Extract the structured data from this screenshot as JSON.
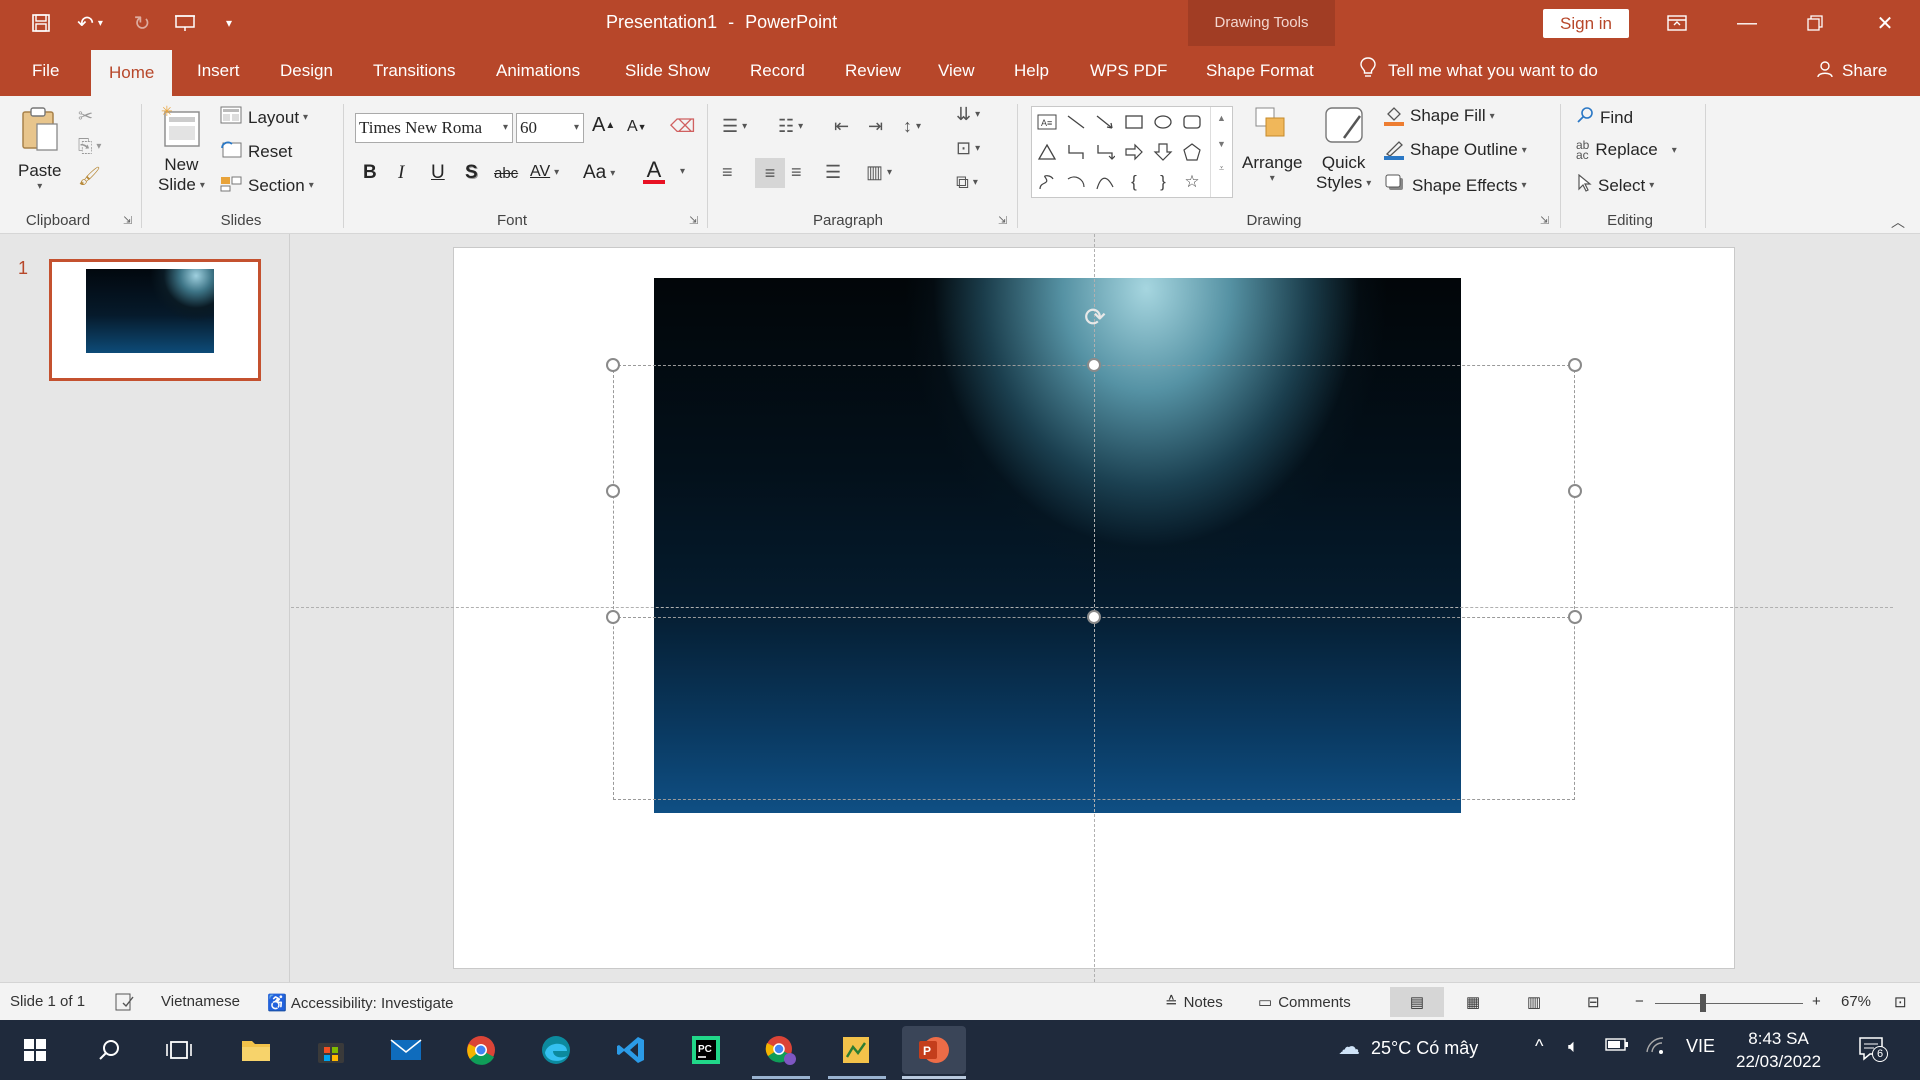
{
  "titlebar": {
    "document_title": "Presentation1",
    "separator": "-",
    "app_name": "PowerPoint",
    "contextual_group": "Drawing Tools",
    "signin": "Sign in",
    "quick_access_icons": [
      "save-icon",
      "undo-icon",
      "redo-icon",
      "present-from-beginning-icon",
      "customize-toolbar-icon"
    ]
  },
  "tabs": [
    "File",
    "Home",
    "Insert",
    "Design",
    "Transitions",
    "Animations",
    "Slide Show",
    "Record",
    "Review",
    "View",
    "Help",
    "WPS PDF",
    "Shape Format"
  ],
  "active_tab": "Home",
  "tell_me": "Tell me what you want to do",
  "share": "Share",
  "ribbon": {
    "clipboard": {
      "label": "Clipboard",
      "paste": "Paste"
    },
    "slides": {
      "label": "Slides",
      "new_slide_line1": "New",
      "new_slide_line2": "Slide",
      "layout": "Layout",
      "reset": "Reset",
      "section": "Section"
    },
    "font": {
      "label": "Font",
      "font_name": "Times New Roma",
      "font_size": "60",
      "bold": "B",
      "italic": "I",
      "underline": "U",
      "shadow": "S",
      "strikethrough": "abc",
      "spacing": "AV",
      "case": "Aa",
      "color": "A",
      "grow": "A",
      "shrink": "A"
    },
    "paragraph": {
      "label": "Paragraph"
    },
    "drawing": {
      "label": "Drawing",
      "arrange": "Arrange",
      "quick_styles_line1": "Quick",
      "quick_styles_line2": "Styles",
      "shape_fill": "Shape Fill",
      "shape_outline": "Shape Outline",
      "shape_effects": "Shape Effects"
    },
    "editing": {
      "label": "Editing",
      "find": "Find",
      "replace": "Replace",
      "select": "Select"
    }
  },
  "thumbnails": [
    {
      "number": "1"
    }
  ],
  "statusbar": {
    "slide_info": "Slide 1 of 1",
    "language": "Vietnamese",
    "accessibility": "Accessibility: Investigate",
    "notes": "Notes",
    "comments": "Comments",
    "zoom": "67%",
    "zoom_minus": "−",
    "zoom_plus": "+"
  },
  "taskbar": {
    "apps": [
      "windows-start-icon",
      "search-icon",
      "task-view-icon",
      "file-explorer-icon",
      "microsoft-store-icon",
      "mail-icon",
      "chrome-icon",
      "edge-icon",
      "vscode-icon",
      "pycharm-icon",
      "chrome-profile-icon",
      "app-icon",
      "powerpoint-icon"
    ],
    "pycharm_label": "PC",
    "weather": "25°C  Có mây",
    "lang": "VIE",
    "time": "8:43 SA",
    "date": "22/03/2022",
    "notification_count": "6"
  },
  "colors": {
    "accent": "#b7472a",
    "taskbar": "#1f2a3c",
    "ribbon": "#f3f3f3"
  }
}
